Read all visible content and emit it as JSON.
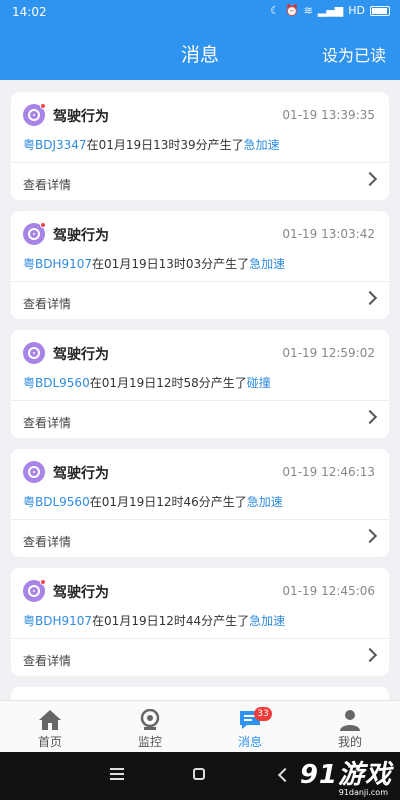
{
  "status_bar": {
    "time": "14:02",
    "network": "HD"
  },
  "header": {
    "title": "消息",
    "action": "设为已读"
  },
  "messages": [
    {
      "title": "驾驶行为",
      "time": "01-19 13:39:35",
      "plate": "粤BDJ3347",
      "text": "在01月19日13时39分产生了",
      "event": "急加速",
      "detail": "查看详情"
    },
    {
      "title": "驾驶行为",
      "time": "01-19 13:03:42",
      "plate": "粤BDH9107",
      "text": "在01月19日13时03分产生了",
      "event": "急加速",
      "detail": "查看详情"
    },
    {
      "title": "驾驶行为",
      "time": "01-19 12:59:02",
      "plate": "粤BDL9560",
      "text": "在01月19日12时58分产生了",
      "event": "碰撞",
      "detail": "查看详情"
    },
    {
      "title": "驾驶行为",
      "time": "01-19 12:46:13",
      "plate": "粤BDL9560",
      "text": "在01月19日12时46分产生了",
      "event": "急加速",
      "detail": "查看详情"
    },
    {
      "title": "驾驶行为",
      "time": "01-19 12:45:06",
      "plate": "粤BDH9107",
      "text": "在01月19日12时44分产生了",
      "event": "急加速",
      "detail": "查看详情"
    }
  ],
  "tabbar": {
    "tabs": [
      {
        "label": "首页",
        "icon": "home-icon"
      },
      {
        "label": "监控",
        "icon": "camera-icon"
      },
      {
        "label": "消息",
        "icon": "message-icon"
      },
      {
        "label": "我的",
        "icon": "user-icon"
      }
    ],
    "active": "消息",
    "badge": "33"
  },
  "watermark": {
    "main": "91游戏",
    "sub": "91danji.com"
  },
  "colors": {
    "primary": "#2f93f0",
    "link": "#2f8ce0",
    "badge": "#f23b3b",
    "avatar": "#a784e6"
  }
}
